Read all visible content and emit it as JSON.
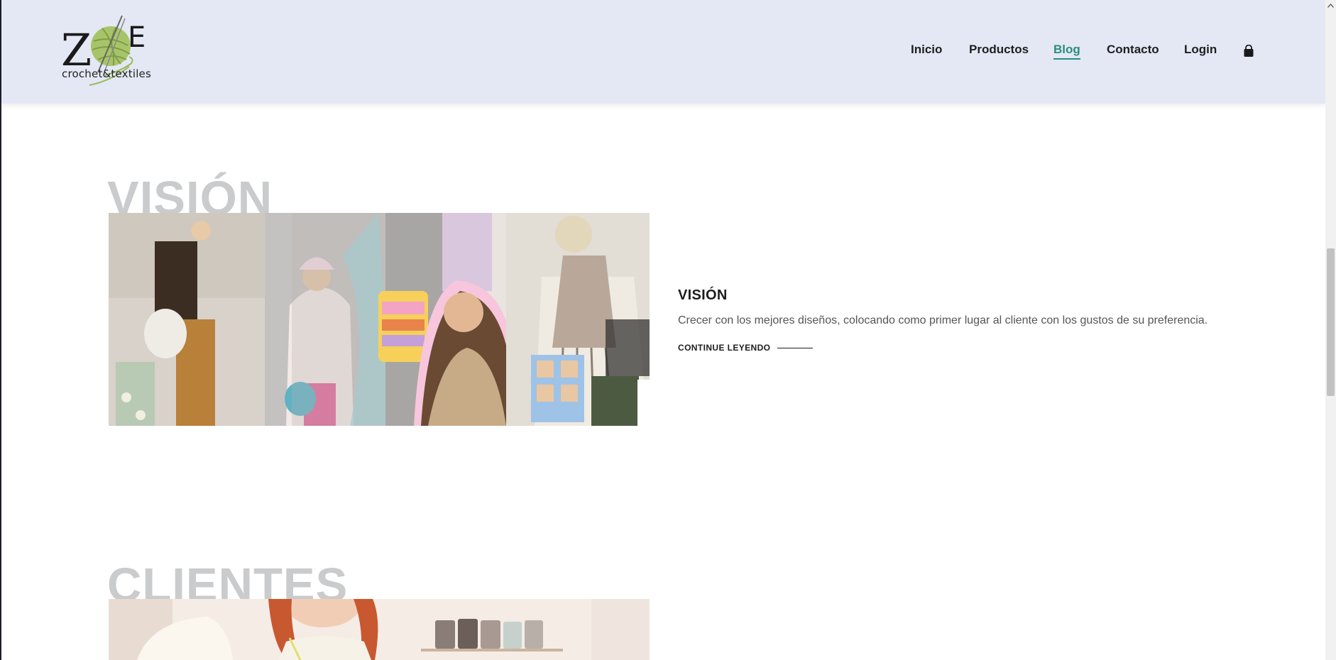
{
  "brand": {
    "logo_letters": "ZOE",
    "logo_tagline": "crochet&textiles"
  },
  "nav": {
    "items": [
      {
        "label": "Inicio",
        "active": false
      },
      {
        "label": "Productos",
        "active": false
      },
      {
        "label": "Blog",
        "active": true
      },
      {
        "label": "Contacto",
        "active": false
      },
      {
        "label": "Login",
        "active": false
      }
    ],
    "cart_icon": "shopping-bag-icon"
  },
  "colors": {
    "header_bg": "#e3e8f4",
    "accent": "#2b8c7f",
    "faded_heading": "#c9cbcd"
  },
  "posts": [
    {
      "bg_heading": "VISIÓN",
      "title": "VISIÓN",
      "excerpt": "Crecer con los mejores diseños, colocando como primer lugar al cliente con los gustos de su preferencia.",
      "read_more": "CONTINUE LEYENDO"
    },
    {
      "bg_heading": "CLIENTES"
    }
  ]
}
